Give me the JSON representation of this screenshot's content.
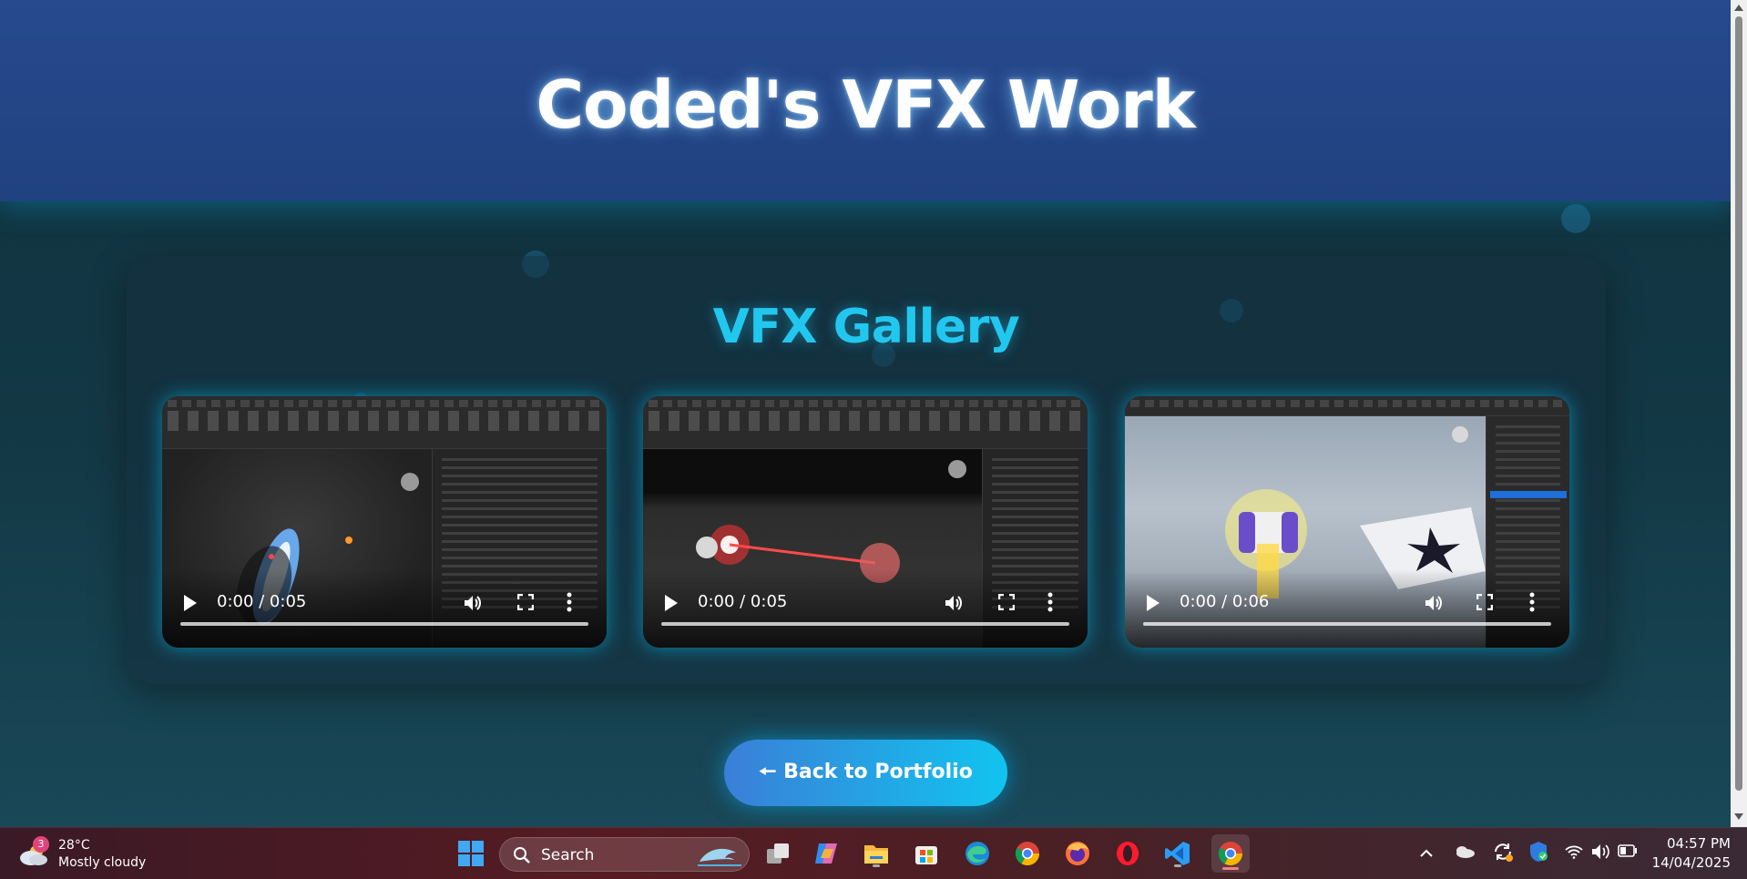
{
  "header": {
    "title": "Coded's VFX Work"
  },
  "gallery": {
    "title": "VFX Gallery",
    "videos": [
      {
        "time": "0:00 / 0:05",
        "thumbnail": "portal-effect"
      },
      {
        "time": "0:00 / 0:05",
        "thumbnail": "red-beam-effect"
      },
      {
        "time": "0:00 / 0:06",
        "thumbnail": "yellow-burst-effect"
      }
    ]
  },
  "back_button": {
    "label": "🠔 Back to Portfolio"
  },
  "taskbar": {
    "weather": {
      "badge": "3",
      "temp": "28°C",
      "desc": "Mostly cloudy"
    },
    "search": {
      "placeholder": "Search"
    },
    "apps": [
      "start-icon",
      "task-view-icon",
      "copilot-icon",
      "file-explorer-icon",
      "store-icon",
      "edge-icon",
      "chrome-icon",
      "firefox-icon",
      "opera-icon",
      "vscode-icon",
      "chrome-active-icon"
    ],
    "clock": {
      "time": "04:57 PM",
      "date": "14/04/2025"
    }
  },
  "colors": {
    "header": "#27498e",
    "accent": "#22c7f0",
    "button_start": "#3a7fd8",
    "button_end": "#11c4ef"
  }
}
